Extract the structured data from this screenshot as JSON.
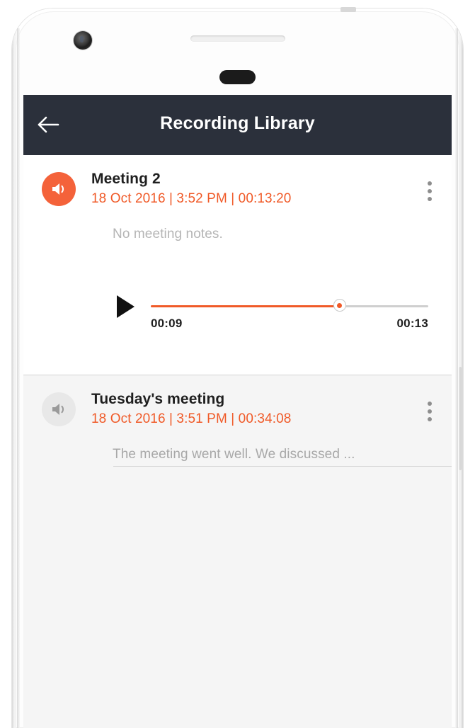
{
  "app": {
    "header": {
      "title": "Recording Library",
      "back_icon": "arrow-left-icon",
      "background_color": "#2b303b",
      "title_color": "#ffffff"
    },
    "theme": {
      "accent_color": "#f05a28",
      "icon_active_bg": "#f4623a",
      "icon_inactive_bg": "#e8e8e8",
      "screen_bg": "#f5f5f5",
      "card_bg": "#ffffff",
      "muted_text": "#b5b5b5"
    }
  },
  "recordings": [
    {
      "title": "Meeting 2",
      "meta": "18 Oct 2016 | 3:52 PM | 00:13:20",
      "notes": "No meeting notes.",
      "icon": "speaker-icon",
      "state": "expanded",
      "overflow_icon": "more-vertical-icon",
      "player": {
        "play_icon": "play-icon",
        "current_time": "00:09",
        "total_time": "00:13",
        "progress_percent": 68
      }
    },
    {
      "title": "Tuesday's meeting",
      "meta": "18 Oct 2016 | 3:51 PM | 00:34:08",
      "notes": "The meeting went well. We discussed ...",
      "icon": "speaker-icon",
      "state": "collapsed",
      "overflow_icon": "more-vertical-icon"
    }
  ]
}
